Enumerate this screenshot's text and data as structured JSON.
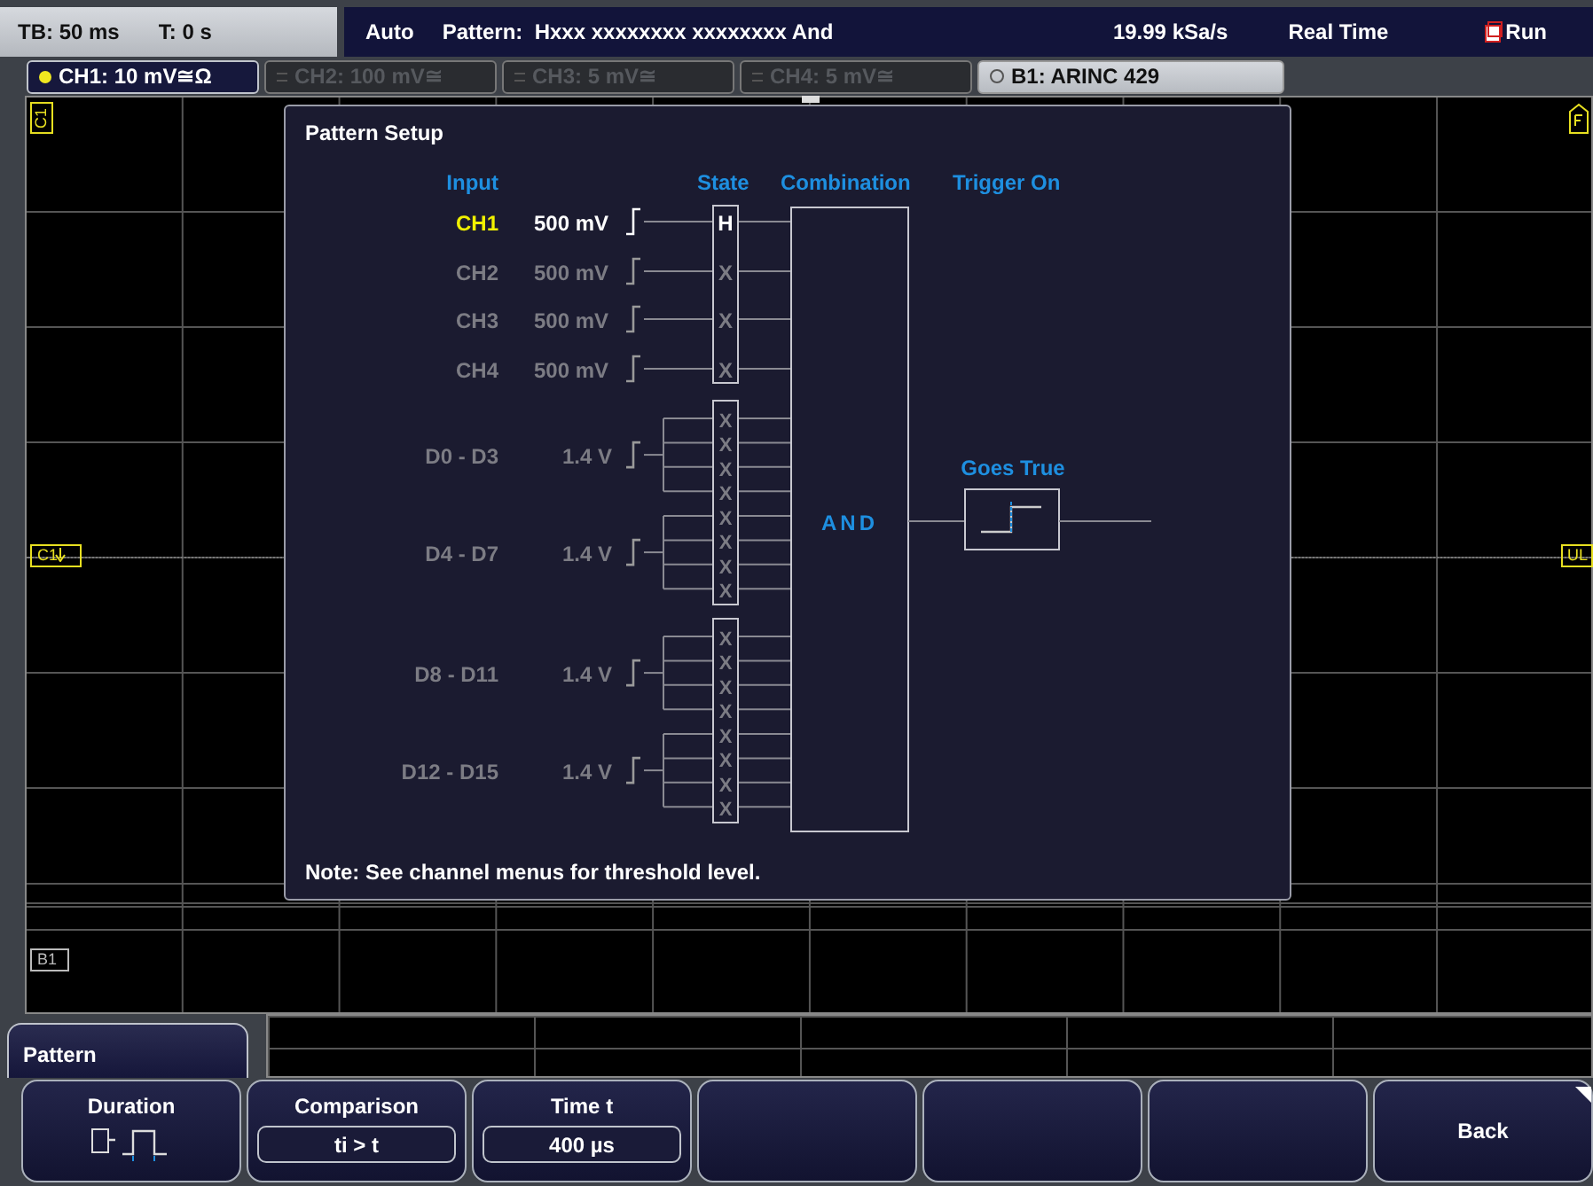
{
  "status_bar": {
    "timebase": "TB: 50 ms",
    "trigger_time": "T: 0 s",
    "mode": "Auto",
    "pattern": "Pattern:  Hxxx xxxxxxxx xxxxxxxx And",
    "sample_rate": "19.99 kSa/s",
    "acquisition": "Real Time",
    "run_state": "Run"
  },
  "channel_tabs": [
    {
      "kind": "analog",
      "label": "CH1: 10 mV≅Ω",
      "on": true
    },
    {
      "kind": "analog",
      "label": "CH2: 100 mV≅",
      "on": false
    },
    {
      "kind": "analog",
      "label": "CH3: 5 mV≅",
      "on": false
    },
    {
      "kind": "analog",
      "label": "CH4: 5 mV≅",
      "on": false
    },
    {
      "kind": "bus",
      "label": "B1:  ARINC 429",
      "on": true
    }
  ],
  "grid_markers": {
    "ch1_trigger": "C1",
    "ch1_offset": "C1",
    "bus": "B1",
    "level": "UL"
  },
  "dialog": {
    "title": "Pattern Setup",
    "headers": {
      "input": "Input",
      "state": "State",
      "combination": "Combination",
      "trigger_on": "Trigger On"
    },
    "analog_inputs": [
      {
        "name": "CH1",
        "threshold": "500 mV",
        "state": "H",
        "enabled": true
      },
      {
        "name": "CH2",
        "threshold": "500 mV",
        "state": "X",
        "enabled": false
      },
      {
        "name": "CH3",
        "threshold": "500 mV",
        "state": "X",
        "enabled": false
      },
      {
        "name": "CH4",
        "threshold": "500 mV",
        "state": "X",
        "enabled": false
      }
    ],
    "digital_groups": [
      {
        "name": "D0 - D3",
        "threshold": "1.4 V",
        "states": [
          "X",
          "X",
          "X",
          "X"
        ],
        "enabled": false
      },
      {
        "name": "D4 - D7",
        "threshold": "1.4 V",
        "states": [
          "X",
          "X",
          "X",
          "X"
        ],
        "enabled": false
      },
      {
        "name": "D8 - D11",
        "threshold": "1.4 V",
        "states": [
          "X",
          "X",
          "X",
          "X"
        ],
        "enabled": false
      },
      {
        "name": "D12 - D15",
        "threshold": "1.4 V",
        "states": [
          "X",
          "X",
          "X",
          "X"
        ],
        "enabled": false
      }
    ],
    "combination": "AND",
    "trigger_on": "Goes True",
    "note": "Note: See channel menus for threshold level."
  },
  "menu_title": "Pattern",
  "softkeys": [
    {
      "kind": "icon",
      "label": "Duration"
    },
    {
      "kind": "value",
      "label": "Comparison",
      "value": "ti > t"
    },
    {
      "kind": "value",
      "label": "Time t",
      "value": "400 µs"
    },
    {
      "kind": "empty"
    },
    {
      "kind": "empty"
    },
    {
      "kind": "empty"
    },
    {
      "kind": "submenu",
      "label": "Back"
    }
  ]
}
